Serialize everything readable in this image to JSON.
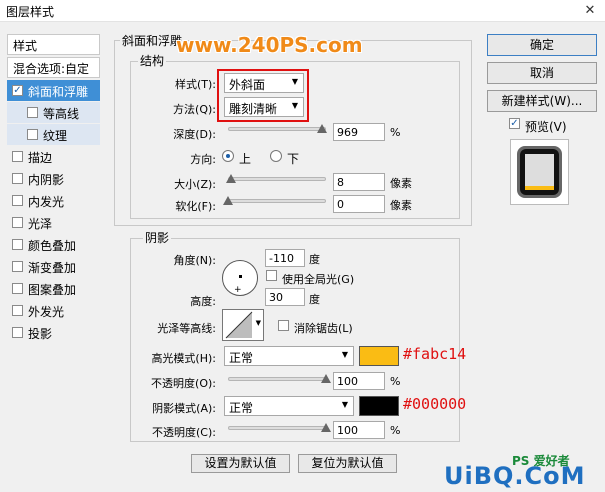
{
  "window": {
    "title": "图层样式"
  },
  "watermark": {
    "text": "www.240PS.com",
    "color": "#f08a18"
  },
  "left_panel": {
    "header": "样式",
    "blend_options": "混合选项:自定",
    "items": [
      {
        "label": "斜面和浮雕",
        "checked": true
      },
      {
        "label": "等高线",
        "checked": false
      },
      {
        "label": "纹理",
        "checked": false
      },
      {
        "label": "描边",
        "checked": false
      },
      {
        "label": "内阴影",
        "checked": false
      },
      {
        "label": "内发光",
        "checked": false
      },
      {
        "label": "光泽",
        "checked": false
      },
      {
        "label": "颜色叠加",
        "checked": false
      },
      {
        "label": "渐变叠加",
        "checked": false
      },
      {
        "label": "图案叠加",
        "checked": false
      },
      {
        "label": "外发光",
        "checked": false
      },
      {
        "label": "投影",
        "checked": false
      }
    ]
  },
  "bevel": {
    "group_title": "斜面和浮雕",
    "structure_title": "结构",
    "style": {
      "label": "样式(T):",
      "value": "外斜面"
    },
    "technique": {
      "label": "方法(Q):",
      "value": "雕刻清晰"
    },
    "depth": {
      "label": "深度(D):",
      "value": "969",
      "unit": "%",
      "slider": 0.96
    },
    "direction": {
      "label": "方向:",
      "up": "上",
      "down": "下",
      "selected": "up"
    },
    "size": {
      "label": "大小(Z):",
      "value": "8",
      "unit": "像素",
      "slider": 0.03
    },
    "soften": {
      "label": "软化(F):",
      "value": "0",
      "unit": "像素",
      "slider": 0.0
    }
  },
  "shading": {
    "group_title": "阴影",
    "angle": {
      "label": "角度(N):",
      "value": "-110",
      "unit": "度"
    },
    "global_light": {
      "label": "使用全局光(G)",
      "checked": false
    },
    "altitude": {
      "label": "高度:",
      "value": "30",
      "unit": "度"
    },
    "gloss_contour": {
      "label": "光泽等高线:"
    },
    "anti_alias": {
      "label": "消除锯齿(L)",
      "checked": false
    },
    "highlight_mode": {
      "label": "高光模式(H):",
      "value": "正常",
      "color": "#fabc14",
      "annotation": "#fabc14"
    },
    "highlight_opacity": {
      "label": "不透明度(O):",
      "value": "100",
      "unit": "%",
      "slider": 1.0
    },
    "shadow_mode": {
      "label": "阴影模式(A):",
      "value": "正常",
      "color": "#000000",
      "annotation": "#000000"
    },
    "shadow_opacity": {
      "label": "不透明度(C):",
      "value": "100",
      "unit": "%",
      "slider": 1.0
    }
  },
  "footer": {
    "make_default": "设置为默认值",
    "reset_default": "复位为默认值"
  },
  "right_panel": {
    "ok": "确定",
    "cancel": "取消",
    "new_style": "新建样式(W)...",
    "preview": {
      "label": "预览(V)",
      "checked": true
    }
  },
  "site_logo": {
    "text": "UiBQ.CoM",
    "ps_text": "PS 爱好者"
  }
}
